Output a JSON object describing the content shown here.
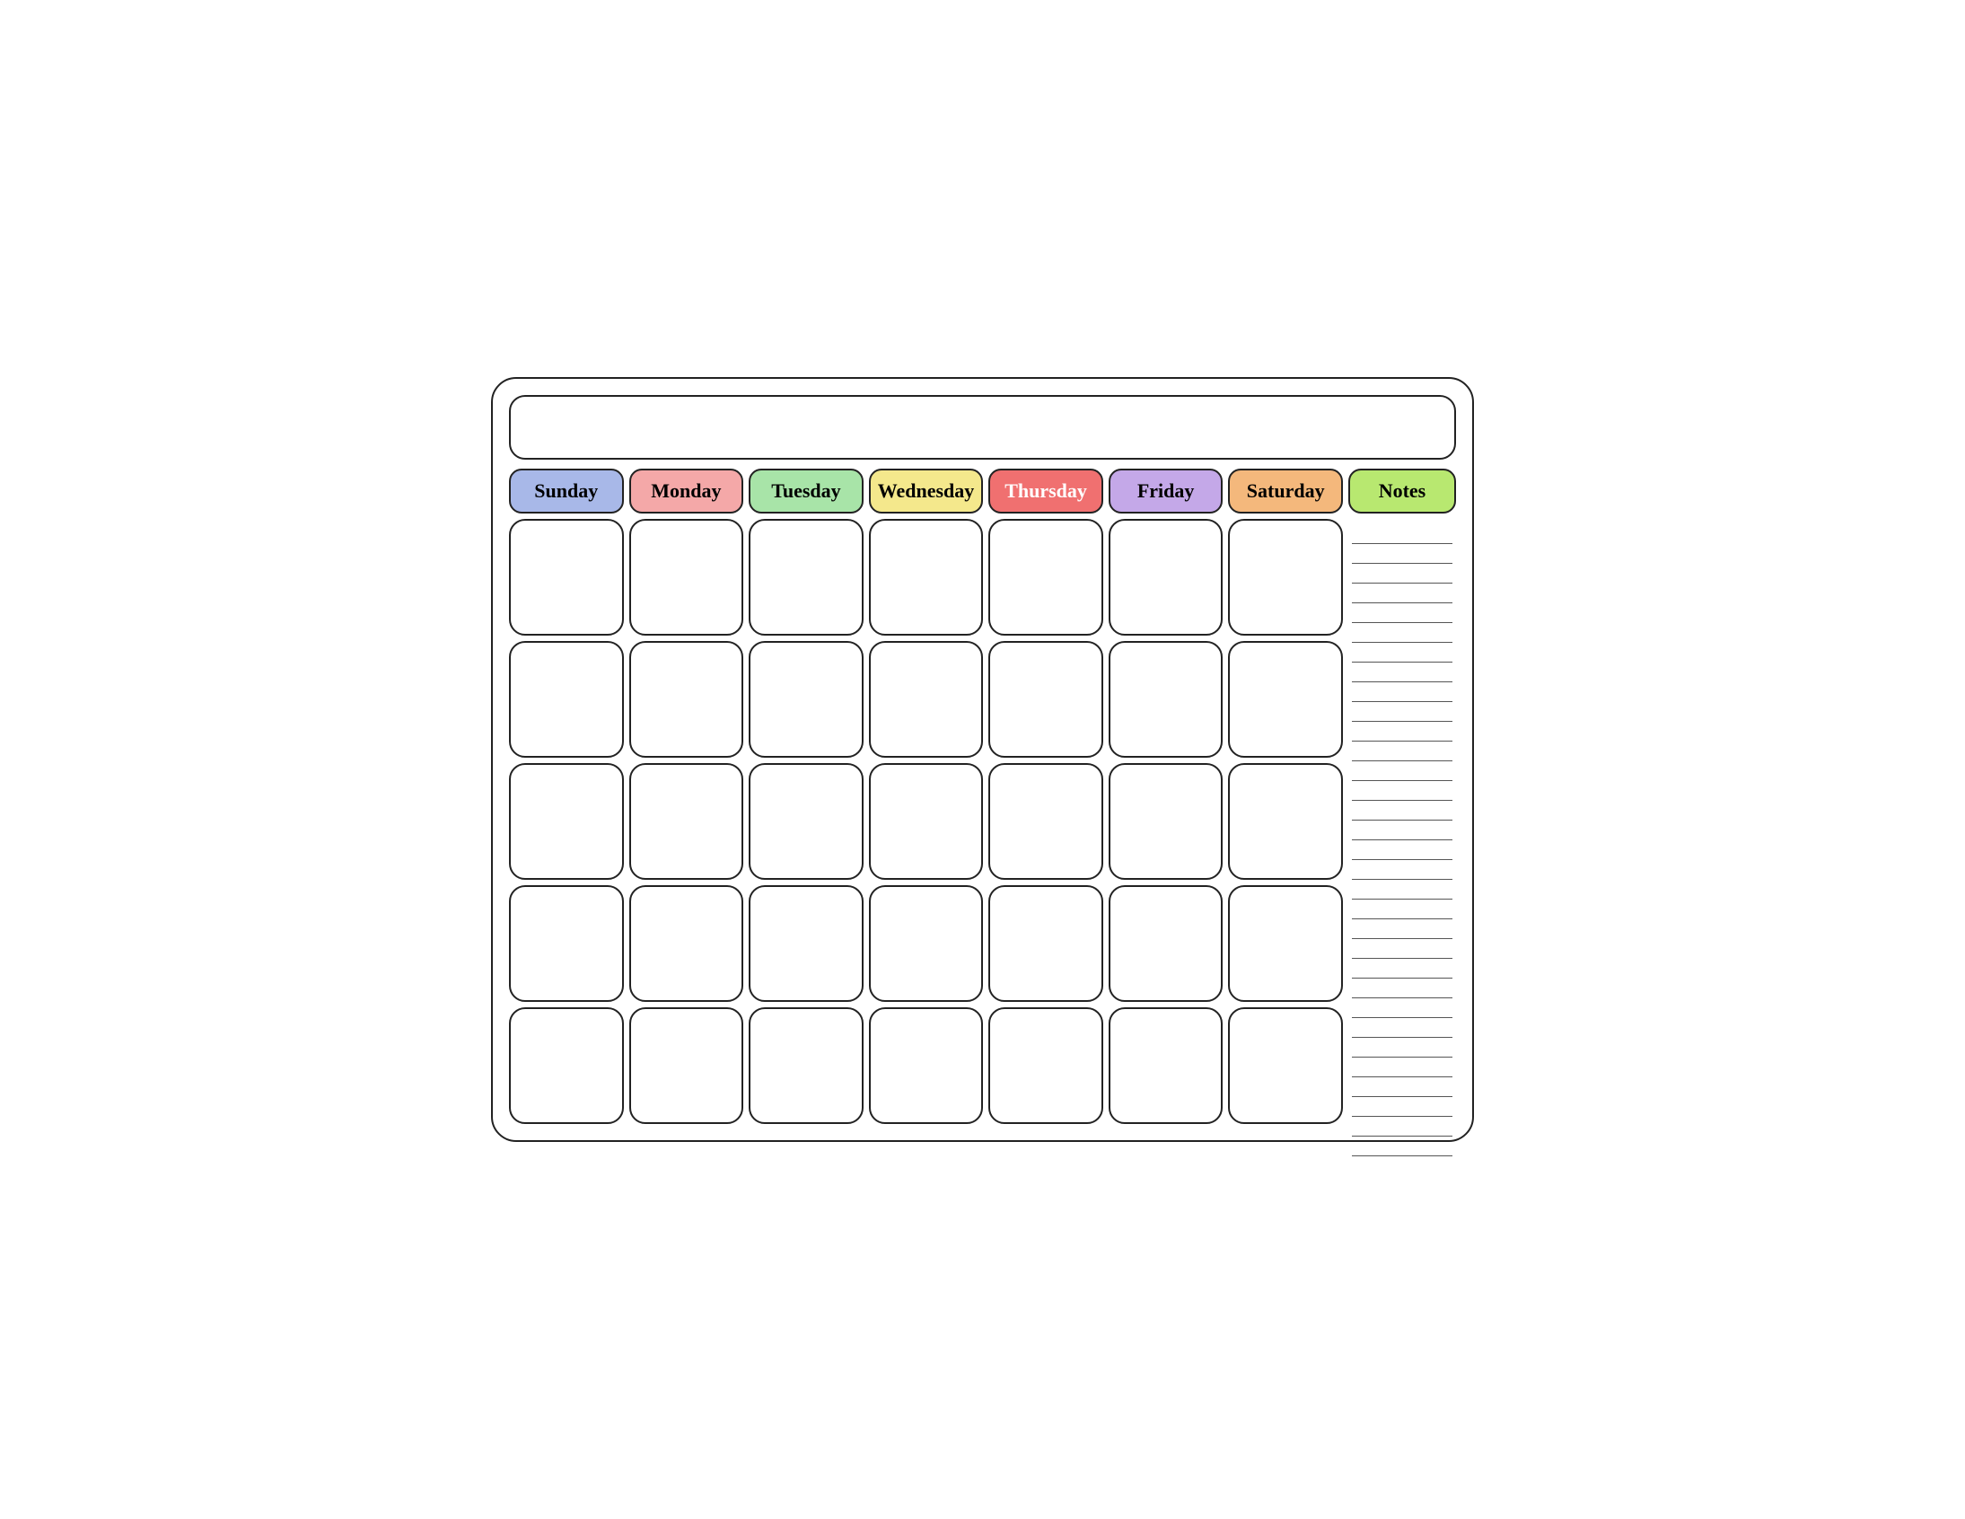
{
  "calendar": {
    "title": "",
    "days": [
      {
        "id": "sunday",
        "label": "Sunday",
        "colorClass": "header-sunday"
      },
      {
        "id": "monday",
        "label": "Monday",
        "colorClass": "header-monday"
      },
      {
        "id": "tuesday",
        "label": "Tuesday",
        "colorClass": "header-tuesday"
      },
      {
        "id": "wednesday",
        "label": "Wednesday",
        "colorClass": "header-wednesday"
      },
      {
        "id": "thursday",
        "label": "Thursday",
        "colorClass": "header-thursday"
      },
      {
        "id": "friday",
        "label": "Friday",
        "colorClass": "header-friday"
      },
      {
        "id": "saturday",
        "label": "Saturday",
        "colorClass": "header-saturday"
      }
    ],
    "notes_label": "Notes",
    "rows": 5,
    "cols": 7,
    "note_lines": 32
  }
}
